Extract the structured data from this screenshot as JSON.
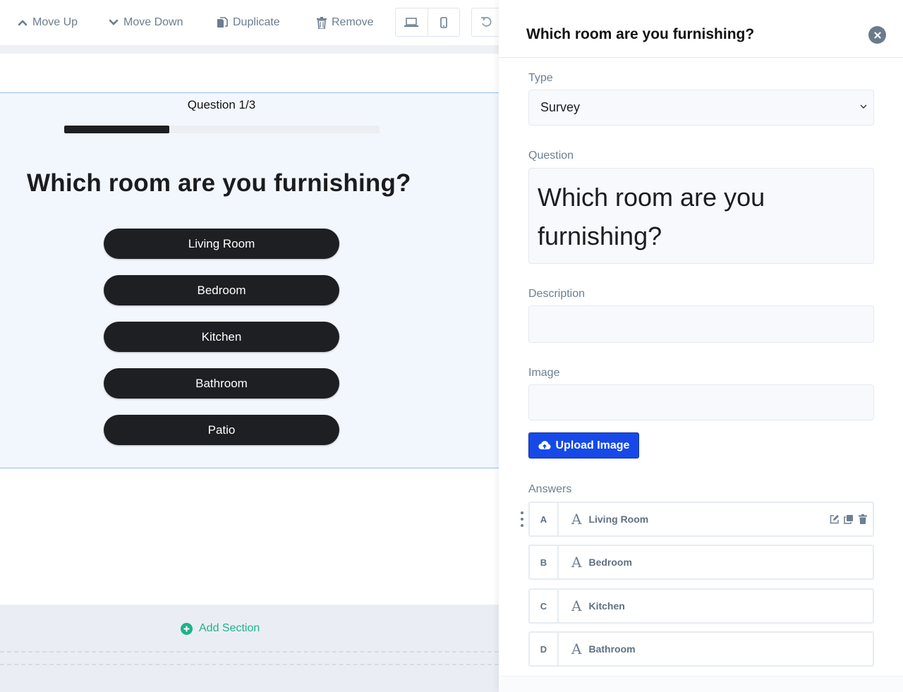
{
  "toolbar": {
    "move_up": "Move Up",
    "move_down": "Move Down",
    "duplicate": "Duplicate",
    "remove": "Remove"
  },
  "preview": {
    "progress_label": "Question 1/3",
    "progress_fraction": 0.333,
    "question_title": "Which room are you furnishing?",
    "answers": [
      "Living Room",
      "Bedroom",
      "Kitchen",
      "Bathroom",
      "Patio"
    ],
    "add_section": "Add Section"
  },
  "panel": {
    "title": "Which room are you furnishing?",
    "type_label": "Type",
    "type_value": "Survey",
    "question_label": "Question",
    "question_value": "Which room are you furnishing?",
    "description_label": "Description",
    "description_value": "",
    "image_label": "Image",
    "image_value": "",
    "upload_button": "Upload Image",
    "answers_label": "Answers",
    "answers": [
      {
        "letter": "A",
        "text": "Living Room"
      },
      {
        "letter": "B",
        "text": "Bedroom"
      },
      {
        "letter": "C",
        "text": "Kitchen"
      },
      {
        "letter": "D",
        "text": "Bathroom"
      }
    ]
  },
  "colors": {
    "accent_blue": "#1749e8",
    "add_section_green": "#1fb28a",
    "answer_button_bg": "#1e1f22",
    "preview_bg": "#f2f7fd"
  },
  "icons": {
    "move_up": "chevron-up-icon",
    "move_down": "chevron-down-icon",
    "duplicate": "duplicate-icon",
    "remove": "trash-icon",
    "desktop": "laptop-icon",
    "mobile": "mobile-icon",
    "undo": "undo-icon",
    "close": "close-icon",
    "upload": "cloud-upload-icon",
    "answer_type": "text-type-icon",
    "edit": "edit-icon",
    "copy": "copy-icon",
    "delete": "trash-icon",
    "add": "plus-circle-icon"
  }
}
